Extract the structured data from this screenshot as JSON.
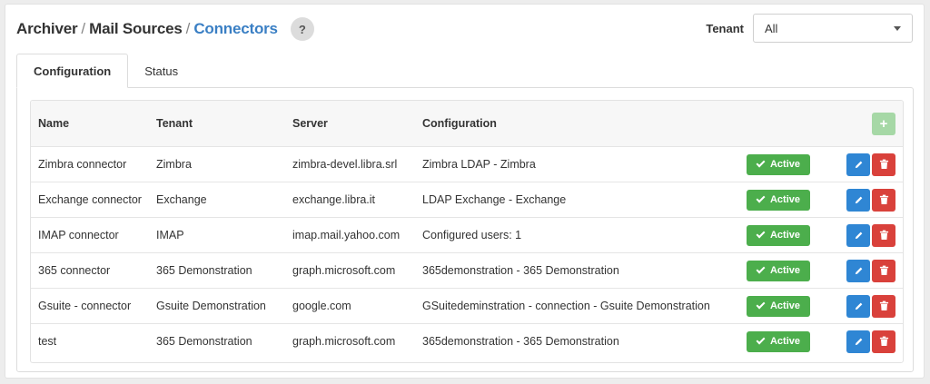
{
  "breadcrumb": {
    "items": [
      "Archiver",
      "Mail Sources",
      "Connectors"
    ],
    "separator": "/"
  },
  "help": {
    "label": "?"
  },
  "tenant": {
    "label": "Tenant",
    "selected": "All"
  },
  "tabs": [
    {
      "label": "Configuration",
      "active": true
    },
    {
      "label": "Status",
      "active": false
    }
  ],
  "table": {
    "headers": {
      "name": "Name",
      "tenant": "Tenant",
      "server": "Server",
      "configuration": "Configuration"
    },
    "add_label": "+",
    "rows": [
      {
        "name": "Zimbra connector",
        "tenant": "Zimbra",
        "server": "zimbra-devel.libra.srl",
        "configuration": "Zimbra LDAP - Zimbra",
        "status": "Active"
      },
      {
        "name": "Exchange connector",
        "tenant": "Exchange",
        "server": "exchange.libra.it",
        "configuration": "LDAP Exchange - Exchange",
        "status": "Active"
      },
      {
        "name": "IMAP connector",
        "tenant": "IMAP",
        "server": "imap.mail.yahoo.com",
        "configuration": "Configured users: 1",
        "status": "Active"
      },
      {
        "name": "365 connector",
        "tenant": "365 Demonstration",
        "server": "graph.microsoft.com",
        "configuration": "365demonstration - 365 Demonstration",
        "status": "Active"
      },
      {
        "name": "Gsuite - connector",
        "tenant": "Gsuite Demonstration",
        "server": "google.com",
        "configuration": "GSuitedeminstration - connection - Gsuite Demonstration",
        "status": "Active"
      },
      {
        "name": "test",
        "tenant": "365 Demonstration",
        "server": "graph.microsoft.com",
        "configuration": "365demonstration - 365 Demonstration",
        "status": "Active"
      }
    ]
  },
  "icons": {
    "edit": "pencil-icon",
    "delete": "trash-icon",
    "status": "check-icon",
    "dropdown": "chevron-down-icon"
  },
  "colors": {
    "active_crumb": "#3a7fc4",
    "active_badge": "#4cae4c",
    "edit_button": "#2f86d4",
    "delete_button": "#d9413b",
    "add_button": "#a6d8a6"
  }
}
